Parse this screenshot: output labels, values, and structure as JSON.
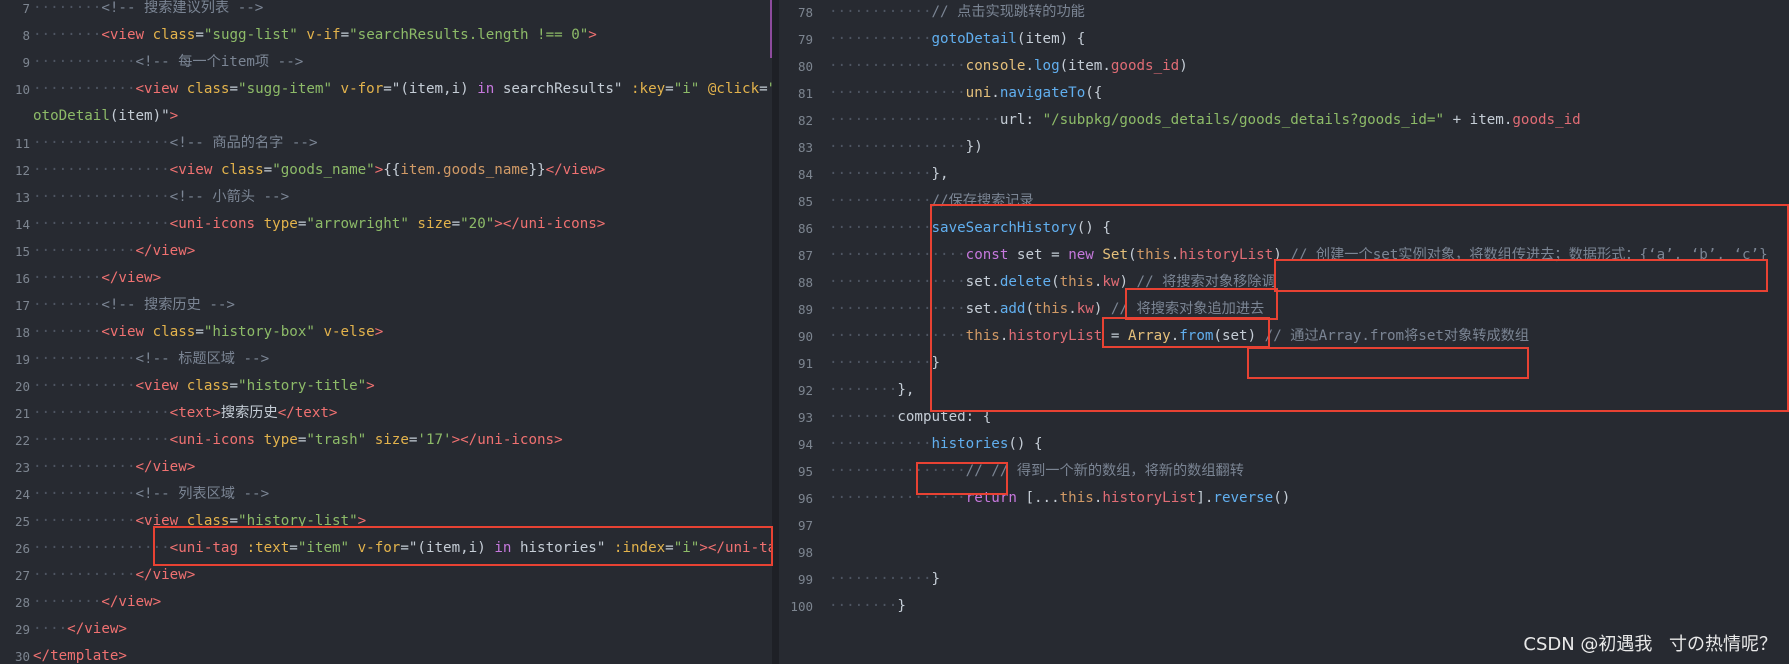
{
  "left_pane": {
    "lines": [
      {
        "num": "7",
        "indent": "········",
        "tokens": [
          [
            "cm",
            "<!-- 搜索建议列表 -->"
          ]
        ]
      },
      {
        "num": "8",
        "indent": "········",
        "tokens": [
          [
            "tg",
            "<view"
          ],
          [
            "tx",
            " "
          ],
          [
            "at",
            "class"
          ],
          [
            "tx",
            "="
          ],
          [
            "st",
            "\"sugg-list\""
          ],
          [
            "tx",
            " "
          ],
          [
            "at",
            "v-if"
          ],
          [
            "tx",
            "="
          ],
          [
            "st",
            "\"searchResults.length !== 0\""
          ],
          [
            "tg",
            ">"
          ]
        ]
      },
      {
        "num": "9",
        "indent": "············",
        "tokens": [
          [
            "cm",
            "<!-- 每一个item项 -->"
          ]
        ]
      },
      {
        "num": "10",
        "indent": "············",
        "tokens": [
          [
            "tg",
            "<view"
          ],
          [
            "tx",
            " "
          ],
          [
            "at",
            "class"
          ],
          [
            "tx",
            "="
          ],
          [
            "st",
            "\"sugg-item\""
          ],
          [
            "tx",
            " "
          ],
          [
            "at",
            "v-for"
          ],
          [
            "tx",
            "=\"(item,i) "
          ],
          [
            "op",
            "in"
          ],
          [
            "tx",
            " searchResults\" "
          ],
          [
            "at",
            ":key"
          ],
          [
            "tx",
            "="
          ],
          [
            "st",
            "\"i\""
          ],
          [
            "tx",
            " "
          ],
          [
            "at",
            "@click"
          ],
          [
            "tx",
            "="
          ],
          [
            "st",
            "\"g"
          ]
        ]
      },
      {
        "num": "",
        "indent": "",
        "tokens": [
          [
            "st",
            "otoDetail"
          ],
          [
            "tx",
            "(item)\""
          ],
          [
            "tg",
            ">"
          ]
        ]
      },
      {
        "num": "11",
        "indent": "················",
        "tokens": [
          [
            "cm",
            "<!-- 商品的名字 -->"
          ]
        ]
      },
      {
        "num": "12",
        "indent": "················",
        "tokens": [
          [
            "tg",
            "<view"
          ],
          [
            "tx",
            " "
          ],
          [
            "at",
            "class"
          ],
          [
            "tx",
            "="
          ],
          [
            "st",
            "\"goods_name\""
          ],
          [
            "tg",
            ">"
          ],
          [
            "tx",
            "{{"
          ],
          [
            "vr",
            "item.goods_name"
          ],
          [
            "tx",
            "}}"
          ],
          [
            "tg",
            "</view>"
          ]
        ]
      },
      {
        "num": "13",
        "indent": "················",
        "tokens": [
          [
            "cm",
            "<!-- 小箭头 -->"
          ]
        ]
      },
      {
        "num": "14",
        "indent": "················",
        "tokens": [
          [
            "tg",
            "<uni-icons"
          ],
          [
            "tx",
            " "
          ],
          [
            "at",
            "type"
          ],
          [
            "tx",
            "="
          ],
          [
            "st",
            "\"arrowright\""
          ],
          [
            "tx",
            " "
          ],
          [
            "at",
            "size"
          ],
          [
            "tx",
            "="
          ],
          [
            "st",
            "\"20\""
          ],
          [
            "tg",
            ">"
          ],
          [
            "tg",
            "</uni-icons>"
          ]
        ]
      },
      {
        "num": "15",
        "indent": "············",
        "tokens": [
          [
            "tg",
            "</view>"
          ]
        ]
      },
      {
        "num": "16",
        "indent": "········",
        "tokens": [
          [
            "tg",
            "</view>"
          ]
        ]
      },
      {
        "num": "17",
        "indent": "········",
        "tokens": [
          [
            "cm",
            "<!-- 搜索历史 -->"
          ]
        ]
      },
      {
        "num": "18",
        "indent": "········",
        "tokens": [
          [
            "tg",
            "<view"
          ],
          [
            "tx",
            " "
          ],
          [
            "at",
            "class"
          ],
          [
            "tx",
            "="
          ],
          [
            "st",
            "\"history-box\""
          ],
          [
            "tx",
            " "
          ],
          [
            "at",
            "v-else"
          ],
          [
            "tg",
            ">"
          ]
        ]
      },
      {
        "num": "19",
        "indent": "············",
        "tokens": [
          [
            "cm",
            "<!-- 标题区域 -->"
          ]
        ]
      },
      {
        "num": "20",
        "indent": "············",
        "tokens": [
          [
            "tg",
            "<view"
          ],
          [
            "tx",
            " "
          ],
          [
            "at",
            "class"
          ],
          [
            "tx",
            "="
          ],
          [
            "st",
            "\"history-title\""
          ],
          [
            "tg",
            ">"
          ]
        ]
      },
      {
        "num": "21",
        "indent": "················",
        "tokens": [
          [
            "tg",
            "<text>"
          ],
          [
            "tx",
            "搜索历史"
          ],
          [
            "tg",
            "</text>"
          ]
        ]
      },
      {
        "num": "22",
        "indent": "················",
        "tokens": [
          [
            "tg",
            "<uni-icons"
          ],
          [
            "tx",
            " "
          ],
          [
            "at",
            "type"
          ],
          [
            "tx",
            "="
          ],
          [
            "st",
            "\"trash\""
          ],
          [
            "tx",
            " "
          ],
          [
            "at",
            "size"
          ],
          [
            "tx",
            "="
          ],
          [
            "st",
            "'17'"
          ],
          [
            "tg",
            ">"
          ],
          [
            "tg",
            "</uni-icons>"
          ]
        ]
      },
      {
        "num": "23",
        "indent": "············",
        "tokens": [
          [
            "tg",
            "</view>"
          ]
        ]
      },
      {
        "num": "24",
        "indent": "············",
        "tokens": [
          [
            "cm",
            "<!-- 列表区域 -->"
          ]
        ]
      },
      {
        "num": "25",
        "indent": "············",
        "tokens": [
          [
            "tg",
            "<view"
          ],
          [
            "tx",
            " "
          ],
          [
            "at",
            "class"
          ],
          [
            "tx",
            "="
          ],
          [
            "st",
            "\"history-list\""
          ],
          [
            "tg",
            ">"
          ]
        ]
      },
      {
        "num": "26",
        "indent": "················",
        "tokens": [
          [
            "tg",
            "<uni-tag"
          ],
          [
            "tx",
            " "
          ],
          [
            "at",
            ":text"
          ],
          [
            "tx",
            "="
          ],
          [
            "st",
            "\"item\""
          ],
          [
            "tx",
            " "
          ],
          [
            "at",
            "v-for"
          ],
          [
            "tx",
            "=\"(item,i) "
          ],
          [
            "op",
            "in"
          ],
          [
            "tx",
            " histories\" "
          ],
          [
            "at",
            ":index"
          ],
          [
            "tx",
            "="
          ],
          [
            "st",
            "\"i\""
          ],
          [
            "tg",
            ">"
          ],
          [
            "tg",
            "</uni-tag>"
          ]
        ]
      },
      {
        "num": "27",
        "indent": "············",
        "tokens": [
          [
            "tg",
            "</view>"
          ]
        ]
      },
      {
        "num": "28",
        "indent": "········",
        "tokens": [
          [
            "tg",
            "</view>"
          ]
        ]
      },
      {
        "num": "29",
        "indent": "····",
        "tokens": [
          [
            "tg",
            "</view>"
          ]
        ]
      },
      {
        "num": "30",
        "indent": "",
        "tokens": [
          [
            "tg",
            "</template>"
          ]
        ]
      }
    ]
  },
  "right_pane": {
    "lines": [
      {
        "num": "78",
        "indent": "············",
        "tokens": [
          [
            "cm",
            "// 点击实现跳转的功能"
          ]
        ]
      },
      {
        "num": "79",
        "indent": "············",
        "tokens": [
          [
            "fn",
            "gotoDetail"
          ],
          [
            "tx",
            "(item) {"
          ]
        ]
      },
      {
        "num": "80",
        "indent": "················",
        "tokens": [
          [
            "cl",
            "console"
          ],
          [
            "tx",
            "."
          ],
          [
            "fn",
            "log"
          ],
          [
            "tx",
            "(item."
          ],
          [
            "pr",
            "goods_id"
          ],
          [
            "tx",
            ")"
          ]
        ]
      },
      {
        "num": "81",
        "indent": "················",
        "tokens": [
          [
            "cl",
            "uni"
          ],
          [
            "tx",
            "."
          ],
          [
            "fn",
            "navigateTo"
          ],
          [
            "tx",
            "({"
          ]
        ]
      },
      {
        "num": "82",
        "indent": "····················",
        "tokens": [
          [
            "tx",
            "url: "
          ],
          [
            "st",
            "\"/subpkg/goods_details/goods_details?goods_id=\""
          ],
          [
            "tx",
            " + item."
          ],
          [
            "pr",
            "goods_id"
          ]
        ]
      },
      {
        "num": "83",
        "indent": "················",
        "tokens": [
          [
            "tx",
            "})"
          ]
        ]
      },
      {
        "num": "84",
        "indent": "············",
        "tokens": [
          [
            "tx",
            "},"
          ]
        ]
      },
      {
        "num": "85",
        "indent": "············",
        "tokens": [
          [
            "cm",
            "//保存搜索记录"
          ]
        ]
      },
      {
        "num": "86",
        "indent": "············",
        "tokens": [
          [
            "fn",
            "saveSearchHistory"
          ],
          [
            "tx",
            "() {"
          ]
        ]
      },
      {
        "num": "87",
        "indent": "················",
        "tokens": [
          [
            "kw",
            "const"
          ],
          [
            "tx",
            " set = "
          ],
          [
            "kw",
            "new"
          ],
          [
            "tx",
            " "
          ],
          [
            "cl",
            "Set"
          ],
          [
            "tx",
            "("
          ],
          [
            "vr",
            "this"
          ],
          [
            "tx",
            "."
          ],
          [
            "pr",
            "historyList"
          ],
          [
            "tx",
            ") "
          ],
          [
            "cm",
            "// 创建一个set实例对象，将数组传进去；数据形式：{‘a’, ‘b’, ‘c’}"
          ]
        ]
      },
      {
        "num": "88",
        "indent": "················",
        "tokens": [
          [
            "tx",
            "set."
          ],
          [
            "fn",
            "delete"
          ],
          [
            "tx",
            "("
          ],
          [
            "vr",
            "this"
          ],
          [
            "tx",
            "."
          ],
          [
            "pr",
            "kw"
          ],
          [
            "tx",
            ") "
          ],
          [
            "cm",
            "// 将搜索对象移除调"
          ]
        ]
      },
      {
        "num": "89",
        "indent": "················",
        "tokens": [
          [
            "tx",
            "set."
          ],
          [
            "fn",
            "add"
          ],
          [
            "tx",
            "("
          ],
          [
            "vr",
            "this"
          ],
          [
            "tx",
            "."
          ],
          [
            "pr",
            "kw"
          ],
          [
            "tx",
            ") "
          ],
          [
            "cm",
            "// 将搜索对象追加进去"
          ]
        ]
      },
      {
        "num": "90",
        "indent": "················",
        "tokens": [
          [
            "vr",
            "this"
          ],
          [
            "tx",
            "."
          ],
          [
            "pr",
            "historyList"
          ],
          [
            "tx",
            " = "
          ],
          [
            "cl",
            "Array"
          ],
          [
            "tx",
            "."
          ],
          [
            "fn",
            "from"
          ],
          [
            "tx",
            "(set) "
          ],
          [
            "cm",
            "// 通过Array.from将set对象转成数组"
          ]
        ]
      },
      {
        "num": "91",
        "indent": "············",
        "tokens": [
          [
            "tx",
            "}"
          ]
        ]
      },
      {
        "num": "92",
        "indent": "········",
        "tokens": [
          [
            "tx",
            "},"
          ]
        ]
      },
      {
        "num": "93",
        "indent": "········",
        "tokens": [
          [
            "tx",
            "computed: {"
          ]
        ]
      },
      {
        "num": "94",
        "indent": "············",
        "tokens": [
          [
            "fn",
            "histories"
          ],
          [
            "tx",
            "() {"
          ]
        ]
      },
      {
        "num": "95",
        "indent": "················",
        "tokens": [
          [
            "cm",
            "// // 得到一个新的数组，将新的数组翻转"
          ]
        ]
      },
      {
        "num": "96",
        "indent": "················",
        "tokens": [
          [
            "kw",
            "return"
          ],
          [
            "tx",
            " [..."
          ],
          [
            "vr",
            "this"
          ],
          [
            "tx",
            "."
          ],
          [
            "pr",
            "historyList"
          ],
          [
            "tx",
            "]."
          ],
          [
            "fn",
            "reverse"
          ],
          [
            "tx",
            "()"
          ]
        ]
      },
      {
        "num": "97",
        "indent": "",
        "tokens": []
      },
      {
        "num": "98",
        "indent": "",
        "tokens": []
      },
      {
        "num": "99",
        "indent": "············",
        "tokens": [
          [
            "tx",
            "}"
          ]
        ]
      },
      {
        "num": "100",
        "indent": "········",
        "tokens": [
          [
            "tx",
            "}"
          ]
        ]
      }
    ]
  },
  "watermark": "CSDN @初遇我ㅤ寸の热情呢？",
  "colors": {
    "highlight_box": "#e84233",
    "scroll_thumb": "#8e4b9e"
  }
}
